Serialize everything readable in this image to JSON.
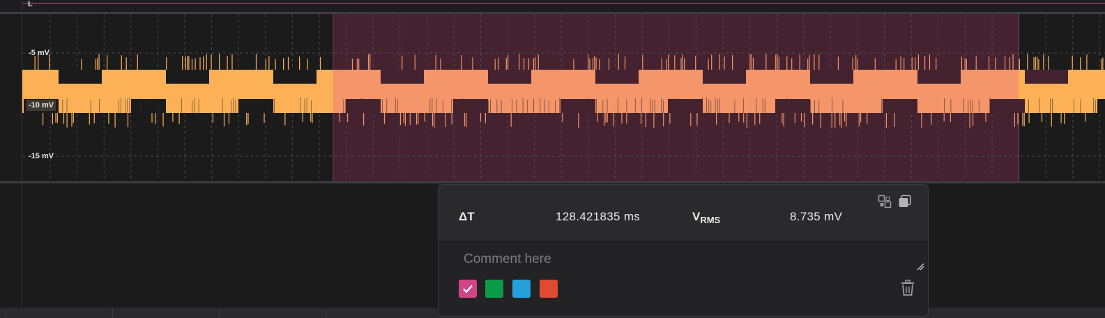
{
  "top_marker": {
    "label": "L",
    "color": "#c7537a"
  },
  "axis": {
    "labels": [
      "-5 mV",
      "-10 mV",
      "-15 mV"
    ],
    "highlighted_label": "-10 mV"
  },
  "colors": {
    "background": "#1b1b1c",
    "signal": "#fdb157",
    "signal_highlighted": "#f4956a",
    "selection_region": "#45222f",
    "grid": "#555557"
  },
  "measurement": {
    "delta_t_label": "ΔT",
    "delta_t_value": "128.421835 ms",
    "vrms_label_main": "V",
    "vrms_label_sub": "RMS",
    "vrms_value": "8.735 mV",
    "comment_placeholder": "Comment here",
    "comment_value": "",
    "icons": [
      "split-view-icon",
      "copy-icon",
      "trash-icon",
      "resize-grip-icon",
      "checkmark-icon"
    ],
    "swatches": [
      {
        "name": "pink",
        "color": "#d14586",
        "selected": true
      },
      {
        "name": "green",
        "color": "#0a9b48",
        "selected": false
      },
      {
        "name": "blue",
        "color": "#26a0d9",
        "selected": false
      },
      {
        "name": "red",
        "color": "#e04a33",
        "selected": false
      }
    ]
  }
}
